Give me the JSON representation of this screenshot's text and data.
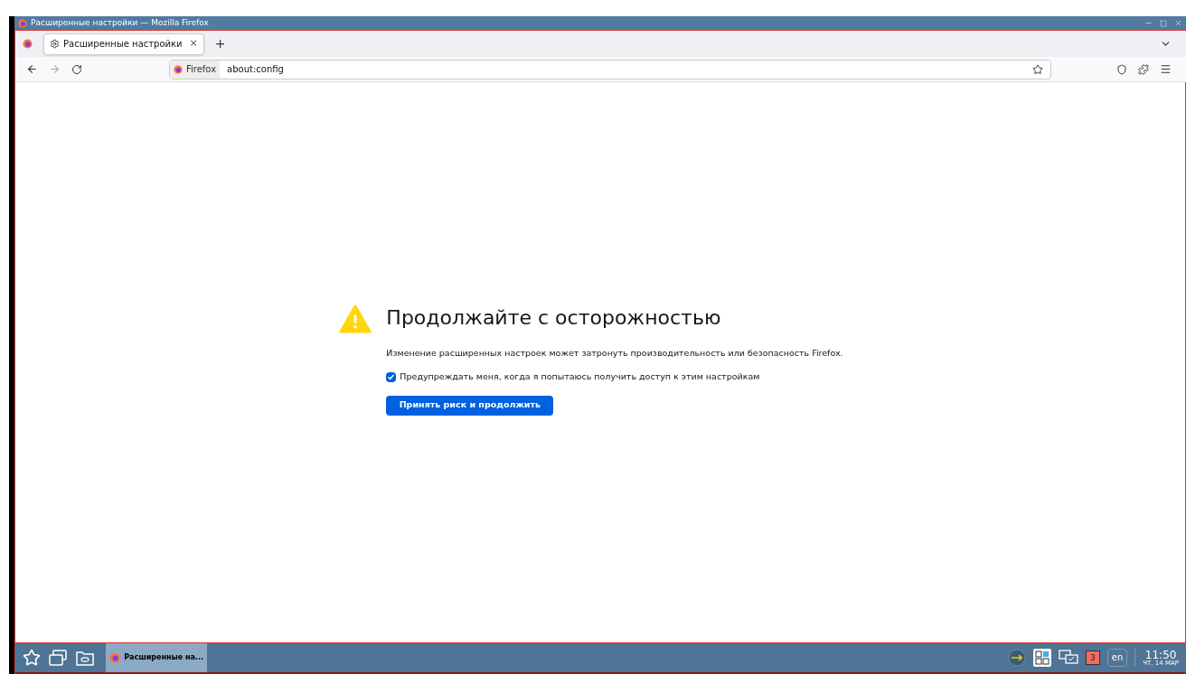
{
  "window": {
    "title": "Расширенные настройки — Mozilla Firefox"
  },
  "tabs": [
    {
      "label": "Расширенные настройки",
      "close": "×",
      "selected": true
    }
  ],
  "new_tab": "+",
  "address_bar": {
    "identity": "Firefox",
    "value": "about:config"
  },
  "warning": {
    "heading": "Продолжайте с осторожностью",
    "text": "Изменение расширенных настроек может затронуть производительность или безопасность Firefox.",
    "checkbox": {
      "label": "Предупреждать меня, когда я попытаюсь получить доступ к этим настройкам",
      "checked": true
    },
    "button": "Принять риск и продолжить"
  },
  "taskbar": {
    "tasks": [
      {
        "label": "Расширенные на...",
        "selected": true
      }
    ],
    "notifications": "3",
    "language": "en",
    "time": "11:50",
    "date": "ЧТ, 14 МАР"
  }
}
